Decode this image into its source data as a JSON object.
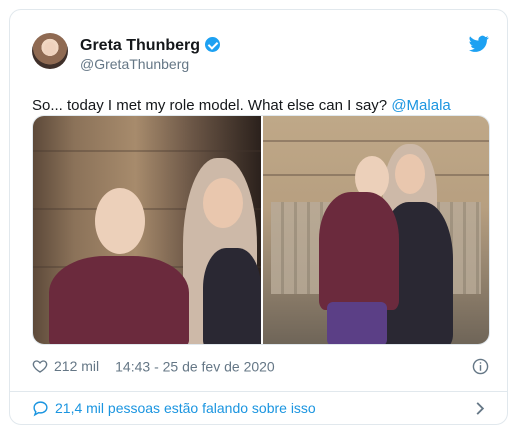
{
  "tweet": {
    "display_name": "Greta Thunberg",
    "handle": "@GretaThunberg",
    "text_before": "So... today I met my role model. What else can I say? ",
    "mention": "@Malala",
    "likes": "212 mil",
    "timestamp": "14:43 - 25 de fev de 2020",
    "conversation": "21,4 mil pessoas estão falando sobre isso"
  },
  "icons": {
    "verified": "verified-badge-icon",
    "brand": "twitter-bird-icon",
    "like": "heart-icon",
    "info": "info-icon",
    "reply": "chat-bubble-icon",
    "more": "chevron-right-icon"
  },
  "colors": {
    "accent": "#1da1f2",
    "link": "#1b95e0",
    "text": "#14171a",
    "muted": "#657786",
    "border": "#e1e8ed"
  }
}
